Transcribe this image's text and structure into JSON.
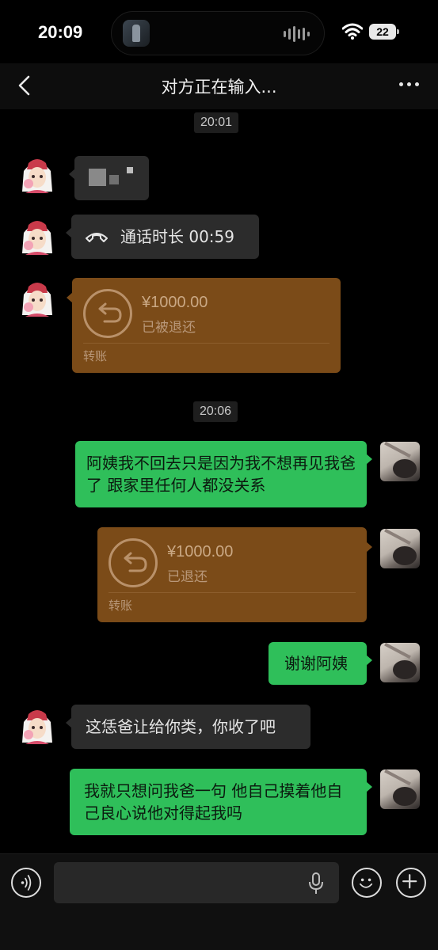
{
  "status_bar": {
    "time": "20:09",
    "battery": "22"
  },
  "nav": {
    "title": "对方正在输入..."
  },
  "messages": [
    {
      "type": "timestamp",
      "text": "20:01"
    },
    {
      "type": "image",
      "side": "left"
    },
    {
      "type": "call",
      "side": "left",
      "text": "通话时长 00:59"
    },
    {
      "type": "transfer",
      "side": "left",
      "amount": "¥1000.00",
      "status": "已被退还",
      "label": "转账"
    },
    {
      "type": "timestamp",
      "text": "20:06"
    },
    {
      "type": "text",
      "side": "right",
      "text": "阿姨我不回去只是因为我不想再见我爸了 跟家里任何人都没关系"
    },
    {
      "type": "transfer",
      "side": "right",
      "amount": "¥1000.00",
      "status": "已退还",
      "label": "转账"
    },
    {
      "type": "text",
      "side": "right",
      "text": "谢谢阿姨"
    },
    {
      "type": "text",
      "side": "left",
      "text": "这恁爸让给你类，你收了吧"
    },
    {
      "type": "text",
      "side": "right",
      "text": "我就只想问我爸一句 他自己摸着他自己良心说他对得起我吗"
    }
  ],
  "icons": {
    "back": "chevron-left-icon",
    "more": "more-dots-icon",
    "call": "phone-icon",
    "transfer": "return-arrow-icon",
    "voice": "voice-icon",
    "mic": "mic-icon",
    "emoji": "emoji-icon",
    "plus": "plus-icon"
  },
  "colors": {
    "sent_bubble": "#2fbf5a",
    "received_bubble": "#2c2c2c",
    "transfer_card": "#7b4b18",
    "background": "#000000"
  },
  "input": {
    "value": ""
  }
}
